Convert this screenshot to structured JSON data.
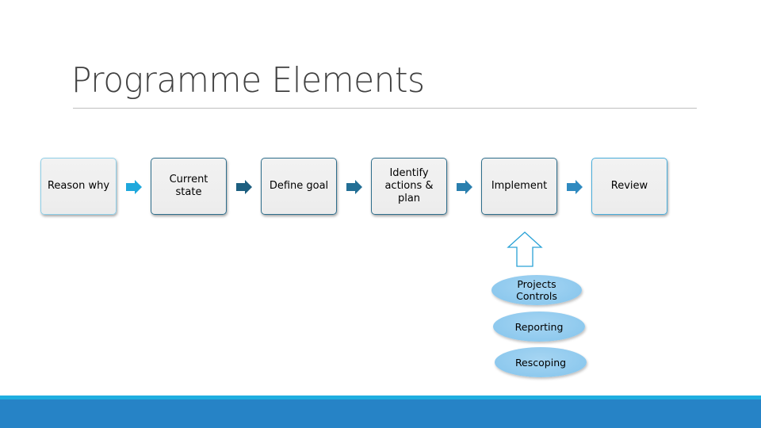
{
  "slide": {
    "title": "Programme Elements"
  },
  "process": {
    "steps": [
      {
        "label": "Reason why",
        "border_color": "#8fcfe8"
      },
      {
        "label": "Current state",
        "border_color": "#2e6e8c"
      },
      {
        "label": "Define goal",
        "border_color": "#2e6e8c"
      },
      {
        "label": "Identify actions & plan",
        "border_color": "#2e6e8c"
      },
      {
        "label": "Implement",
        "border_color": "#2e6e8c"
      },
      {
        "label": "Review",
        "border_color": "#4aaedc"
      }
    ],
    "arrow_colors": [
      "#1fa8dc",
      "#1d5f80",
      "#236f95",
      "#2a7fae",
      "#2f8ac0"
    ]
  },
  "implement_support": {
    "items": [
      {
        "label": "Projects Controls"
      },
      {
        "label": "Reporting"
      },
      {
        "label": "Rescoping"
      }
    ],
    "up_arrow_color": "#2aa2d6"
  },
  "theme": {
    "footer_accent": "#1faee0",
    "footer_main": "#2683c6"
  }
}
